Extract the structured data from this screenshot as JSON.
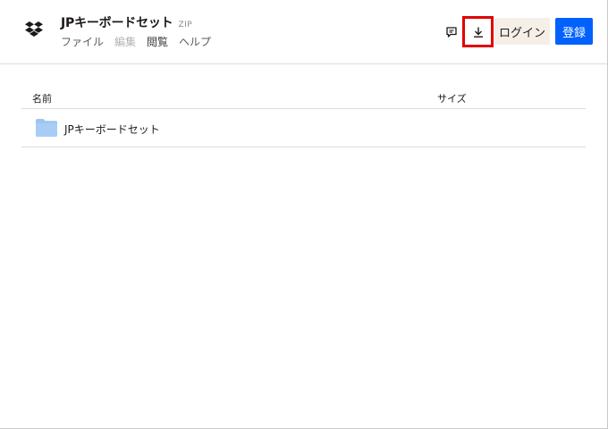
{
  "header": {
    "file_title": "JPキーボードセット",
    "file_ext": "ZIP",
    "menu": [
      {
        "label": "ファイル",
        "state": "normal"
      },
      {
        "label": "編集",
        "state": "disabled"
      },
      {
        "label": "閲覧",
        "state": "normal"
      },
      {
        "label": "ヘルプ",
        "state": "normal"
      }
    ],
    "login_label": "ログイン",
    "register_label": "登録",
    "icons": [
      "dropbox-logo",
      "comment-icon",
      "download-icon"
    ]
  },
  "table": {
    "columns": [
      "名前",
      "サイズ"
    ],
    "rows": [
      {
        "name": "JPキーボードセット",
        "size": "",
        "icon": "folder-icon"
      }
    ]
  },
  "colors": {
    "brand_blue": "#0061fe",
    "highlight_red": "#e00000",
    "login_bg": "#f5efe7",
    "folder_blue": "#a8cdf5"
  }
}
